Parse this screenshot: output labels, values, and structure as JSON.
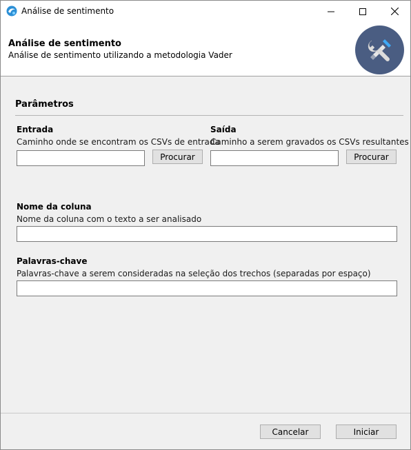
{
  "window": {
    "title": "Análise de sentimento",
    "icon": "app-logo-icon"
  },
  "header": {
    "title": "Análise de sentimento",
    "subtitle": "Análise de sentimento utilizando a metodologia Vader",
    "badge_icon": "tools-icon",
    "badge_color": "#4a5d82"
  },
  "parameters": {
    "section_title": "Parâmetros",
    "input": {
      "label": "Entrada",
      "description": "Caminho onde se encontram os CSVs de entrada",
      "value": "",
      "browse_label": "Procurar"
    },
    "output": {
      "label": "Saída",
      "description": "Caminho a serem gravados os CSVs resultantes",
      "value": "",
      "browse_label": "Procurar"
    },
    "column": {
      "label": "Nome da coluna",
      "description": "Nome da coluna com o texto a ser analisado",
      "value": ""
    },
    "keywords": {
      "label": "Palavras-chave",
      "description": "Palavras-chave a serem consideradas na seleção dos trechos (separadas por espaço)",
      "value": ""
    }
  },
  "footer": {
    "cancel_label": "Cancelar",
    "start_label": "Iniciar"
  }
}
